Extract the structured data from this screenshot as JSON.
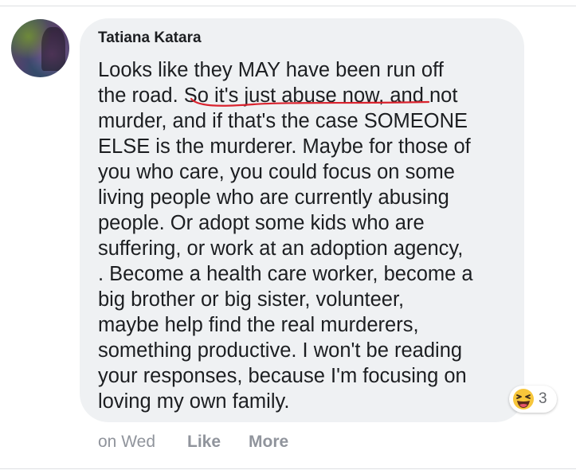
{
  "comment": {
    "author": "Tatiana Katara",
    "text": "Looks like they MAY have been run off\nthe road. So it's just abuse now, and not\nmurder, and if that's the case SOMEONE\nELSE is the murderer. Maybe for those of\nyou who care, you could focus on some\nliving people who are currently abusing\npeople. Or adopt some kids who are\nsuffering, or work at an adoption agency,\n. Become a health care worker, become a\nbig brother or big sister, volunteer,\nmaybe help find the real murderers,\nsomething productive. I won't be reading\nyour responses, because I'm focusing on\nloving my own family.",
    "reaction": {
      "icon": "laughing-emoji-icon",
      "count": "3"
    },
    "timestamp": "on Wed",
    "actions": {
      "like_label": "Like",
      "more_label": "More"
    }
  },
  "colors": {
    "bubble": "#eff1f3",
    "text": "#1c1e21",
    "muted": "#90949c",
    "annotation_underline": "#d9232e"
  }
}
